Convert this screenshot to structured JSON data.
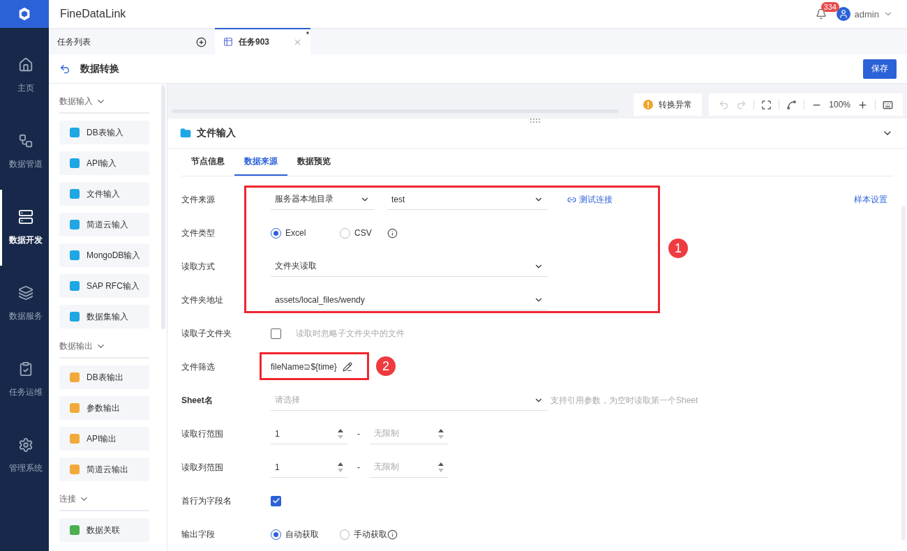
{
  "app": {
    "name": "FineDataLink",
    "notifications": "334",
    "user": "admin"
  },
  "nav": [
    {
      "label": "主页",
      "selected": false
    },
    {
      "label": "数据管道",
      "selected": false
    },
    {
      "label": "数据开发",
      "selected": true
    },
    {
      "label": "数据服务",
      "selected": false
    },
    {
      "label": "任务运维",
      "selected": false
    },
    {
      "label": "管理系统",
      "selected": false
    }
  ],
  "tabs": [
    {
      "label": "任务列表",
      "kind": "list",
      "selected": false
    },
    {
      "label": "任务903",
      "kind": "task",
      "selected": true,
      "mark": "*"
    }
  ],
  "page": {
    "title": "数据转换",
    "save": "保存"
  },
  "palette": [
    {
      "title": "数据输入",
      "expanded": true,
      "items": [
        {
          "label": "DB表输入",
          "color": "#1ea7e4"
        },
        {
          "label": "API输入",
          "color": "#1ea7e4"
        },
        {
          "label": "文件输入",
          "color": "#1ea7e4"
        },
        {
          "label": "简道云输入",
          "color": "#1ea7e4"
        },
        {
          "label": "MongoDB输入",
          "color": "#1ea7e4"
        },
        {
          "label": "SAP RFC输入",
          "color": "#1ea7e4"
        },
        {
          "label": "数据集输入",
          "color": "#1ea7e4"
        }
      ]
    },
    {
      "title": "数据输出",
      "expanded": true,
      "items": [
        {
          "label": "DB表输出",
          "color": "#f2a93b"
        },
        {
          "label": "参数输出",
          "color": "#f2a93b"
        },
        {
          "label": "API输出",
          "color": "#f2a93b"
        },
        {
          "label": "简道云输出",
          "color": "#f2a93b"
        }
      ]
    },
    {
      "title": "连接",
      "expanded": true,
      "items": [
        {
          "label": "数据关联",
          "color": "#4caf50"
        }
      ]
    }
  ],
  "canvas": {
    "status": "转换异常",
    "zoom": "100%"
  },
  "panel": {
    "title": "文件输入",
    "sample_link": "样本设置",
    "tabs": [
      {
        "label": "节点信息",
        "selected": false
      },
      {
        "label": "数据来源",
        "selected": true
      },
      {
        "label": "数据预览",
        "selected": false
      }
    ],
    "fields": [
      {
        "kind": "select_pair",
        "label": "文件来源",
        "values": [
          "服务器本地目录",
          "test"
        ],
        "link": "测试连接"
      },
      {
        "kind": "radio",
        "label": "文件类型",
        "options": [
          {
            "label": "Excel",
            "selected": true
          },
          {
            "label": "CSV",
            "selected": false
          }
        ],
        "info": true
      },
      {
        "kind": "select",
        "label": "读取方式",
        "value": "文件夹读取"
      },
      {
        "kind": "select",
        "label": "文件夹地址",
        "value": "assets/local_files/wendy"
      },
      {
        "kind": "checkbox",
        "label": "读取子文件夹",
        "checked": false,
        "hint": "读取时忽略子文件夹中的文件"
      },
      {
        "kind": "filter",
        "label": "文件筛选",
        "value": "fileName⊇${time}"
      },
      {
        "kind": "select",
        "label": "Sheet名",
        "placeholder": "请选择",
        "hint": "支持引用参数，为空时读取第一个Sheet"
      },
      {
        "kind": "range",
        "label": "读取行范围",
        "from": "1",
        "separator": "-",
        "to_placeholder": "无限制"
      },
      {
        "kind": "range",
        "label": "读取列范围",
        "from": "1",
        "separator": "-",
        "to_placeholder": "无限制"
      },
      {
        "kind": "checkbox",
        "label": "首行为字段名",
        "checked": true
      },
      {
        "kind": "radio",
        "label": "输出字段",
        "options": [
          {
            "label": "自动获取",
            "selected": true
          },
          {
            "label": "手动获取",
            "selected": false
          }
        ],
        "info": true
      }
    ]
  },
  "annotations": [
    {
      "label": "1"
    },
    {
      "label": "2"
    }
  ]
}
